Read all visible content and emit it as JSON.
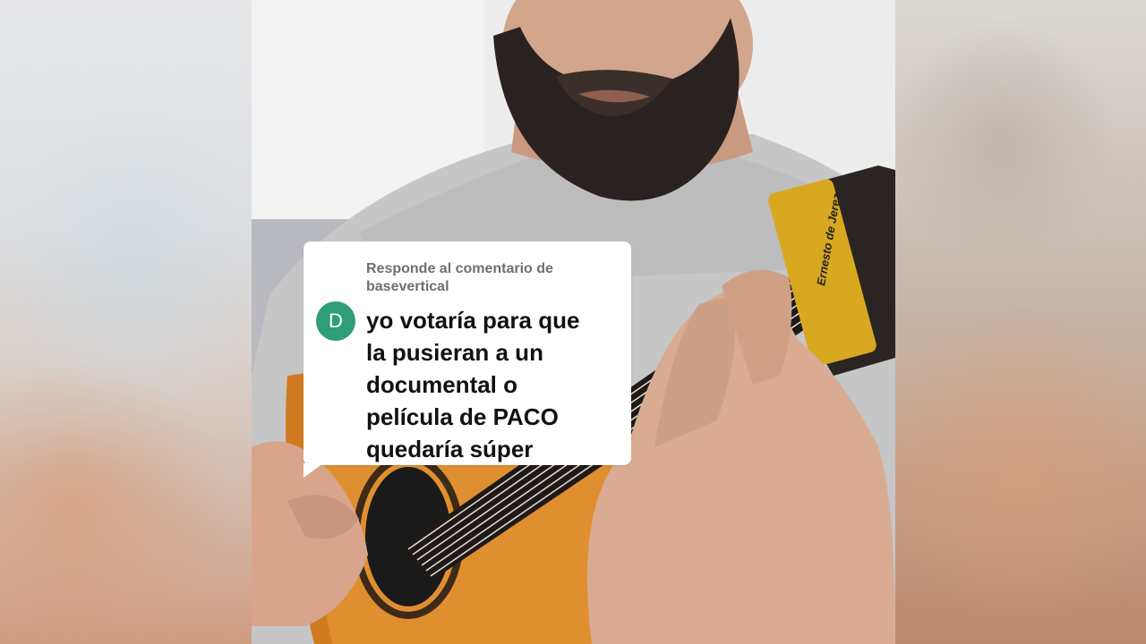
{
  "reply_header": {
    "prefix": "Responde al comentario de",
    "username": "basevertical"
  },
  "comment": {
    "avatar_letter": "D",
    "avatar_color": "#2f9c7a",
    "lines": [
      "yo votaría para que",
      "la pusieran a un",
      "documental o",
      "película de PACO",
      "quedaría súper"
    ]
  },
  "capo_text": "Ernesto de Jerez"
}
